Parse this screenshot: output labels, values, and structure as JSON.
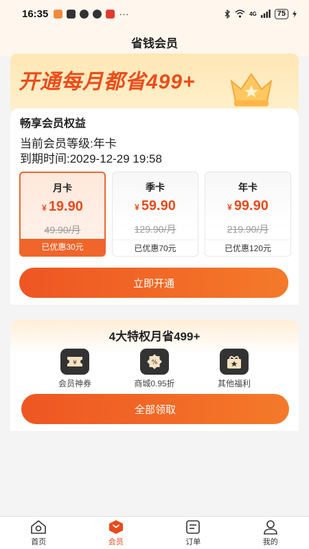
{
  "status_bar": {
    "time": "16:35",
    "network": "4G",
    "battery": "75"
  },
  "header": {
    "title": "省钱会员"
  },
  "banner": {
    "slogan": "开通每月都省499+"
  },
  "membership": {
    "title": "畅享会员权益",
    "level": "当前会员等级:年卡",
    "expire": "到期时间:2029-12-29 19:58",
    "plans": [
      {
        "name": "月卡",
        "currency": "¥",
        "price": "19.90",
        "original": "49.90/月",
        "save": "已优惠30元",
        "selected": true
      },
      {
        "name": "季卡",
        "currency": "¥",
        "price": "59.90",
        "original": "129.90/月",
        "save": "已优惠70元",
        "selected": false
      },
      {
        "name": "年卡",
        "currency": "¥",
        "price": "99.90",
        "original": "219.90/月",
        "save": "已优惠120元",
        "selected": false
      }
    ],
    "open_button": "立即开通"
  },
  "privileges": {
    "title": "4大特权月省499+",
    "items": [
      {
        "label": "会员神券",
        "icon": "coupon-icon"
      },
      {
        "label": "商城0.95折",
        "icon": "discount-icon"
      },
      {
        "label": "其他福利",
        "icon": "gift-icon"
      }
    ],
    "claim_button": "全部领取"
  },
  "bottom_nav": {
    "items": [
      {
        "label": "首页",
        "icon": "home-icon",
        "active": false
      },
      {
        "label": "会员",
        "icon": "member-icon",
        "active": true
      },
      {
        "label": "订单",
        "icon": "order-icon",
        "active": false
      },
      {
        "label": "我的",
        "icon": "profile-icon",
        "active": false
      }
    ]
  },
  "colors": {
    "accent": "#ee5622",
    "price": "#e94a1a",
    "banner": "#ffe7b5"
  }
}
